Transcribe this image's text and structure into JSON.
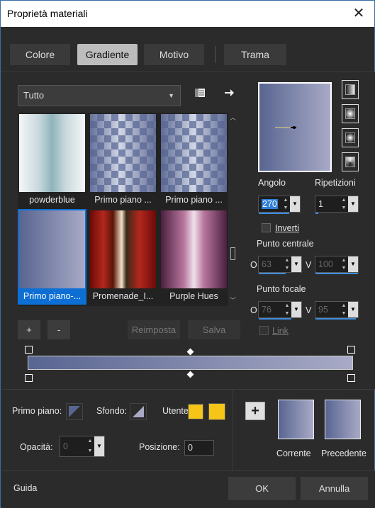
{
  "window": {
    "title": "Proprietà materiali",
    "close_glyph": "✕"
  },
  "tabs": [
    {
      "label": "Colore"
    },
    {
      "label": "Gradiente",
      "active": true
    },
    {
      "label": "Motivo"
    },
    {
      "label": "Trama"
    }
  ],
  "filter": {
    "selected": "Tutto"
  },
  "gradients": [
    {
      "label": "powderblue"
    },
    {
      "label": "Primo piano ..."
    },
    {
      "label": "Primo piano ..."
    },
    {
      "label": "Primo piano-...",
      "selected": true
    },
    {
      "label": "Promenade_I..."
    },
    {
      "label": "Purple Hues"
    }
  ],
  "list_buttons": {
    "add": "+",
    "remove": "-",
    "reset": "Reimposta",
    "save": "Salva"
  },
  "angle": {
    "label": "Angolo",
    "value": "270"
  },
  "repeats": {
    "label": "Ripetizioni",
    "value": "1"
  },
  "invert": {
    "label": "Inverti",
    "checked": false
  },
  "center_point": {
    "label": "Punto centrale",
    "o_label": "O",
    "o_value": "63",
    "v_label": "V",
    "v_value": "100"
  },
  "focal_point": {
    "label": "Punto focale",
    "o_label": "O",
    "o_value": "76",
    "v_label": "V",
    "v_value": "95"
  },
  "link": {
    "label": "Link",
    "checked": false
  },
  "colors": {
    "foreground_label": "Primo piano:",
    "background_label": "Sfondo:",
    "user_label": "Utente:",
    "user_color": "#f5c518",
    "gradient_start": "#586591",
    "gradient_end": "#a8aac6"
  },
  "opacity": {
    "label": "Opacità:",
    "value": "0"
  },
  "position": {
    "label": "Posizione:",
    "value": "0"
  },
  "current": {
    "label": "Corrente"
  },
  "previous": {
    "label": "Precedente"
  },
  "footer": {
    "help": "Guida",
    "ok": "OK",
    "cancel": "Annulla"
  }
}
